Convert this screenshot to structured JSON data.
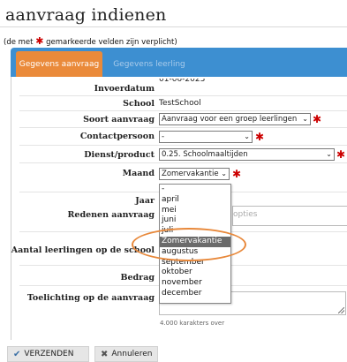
{
  "page": {
    "title": "aanvraag indienen",
    "required_note_prefix": "(de met",
    "required_note_suffix": "gemarkeerde velden zijn verplicht)",
    "required_marker": "✱"
  },
  "tabs": [
    {
      "label": "Gegevens aanvraag"
    },
    {
      "label": "Gegevens leerling"
    }
  ],
  "form": {
    "invoerdatum": {
      "label": "Invoerdatum",
      "value": "01-06-2023"
    },
    "school": {
      "label": "School",
      "value": "TestSchool"
    },
    "soort": {
      "label": "Soort aanvraag",
      "value": "Aanvraag voor een groep leerlingen"
    },
    "contact": {
      "label": "Contactpersoon",
      "value": "-"
    },
    "dienst": {
      "label": "Dienst/product",
      "value": "0.25. Schoolmaaltijden"
    },
    "maand": {
      "label": "Maand",
      "value": "Zomervakantie"
    },
    "jaar": {
      "label": "Jaar"
    },
    "redenen": {
      "label": "Redenen aanvraag",
      "placeholder": "opties"
    },
    "aantal": {
      "label": "Aantal leerlingen op de school"
    },
    "bedrag": {
      "label": "Bedrag"
    },
    "toelichting": {
      "label": "Toelichting op de aanvraag",
      "counter": "4.000 karakters over"
    }
  },
  "month_options": [
    "-",
    "april",
    "mei",
    "juni",
    "juli",
    "Zomervakantie",
    "augustus",
    "september",
    "oktober",
    "november",
    "december"
  ],
  "selected_month_index": 5,
  "buttons": {
    "submit": "VERZENDEN",
    "cancel": "Annuleren"
  },
  "colors": {
    "tab_active": "#ea8a3a",
    "tab_bar": "#3d8fd1",
    "required": "#cc0000",
    "highlight_ellipse": "#e8883a"
  }
}
